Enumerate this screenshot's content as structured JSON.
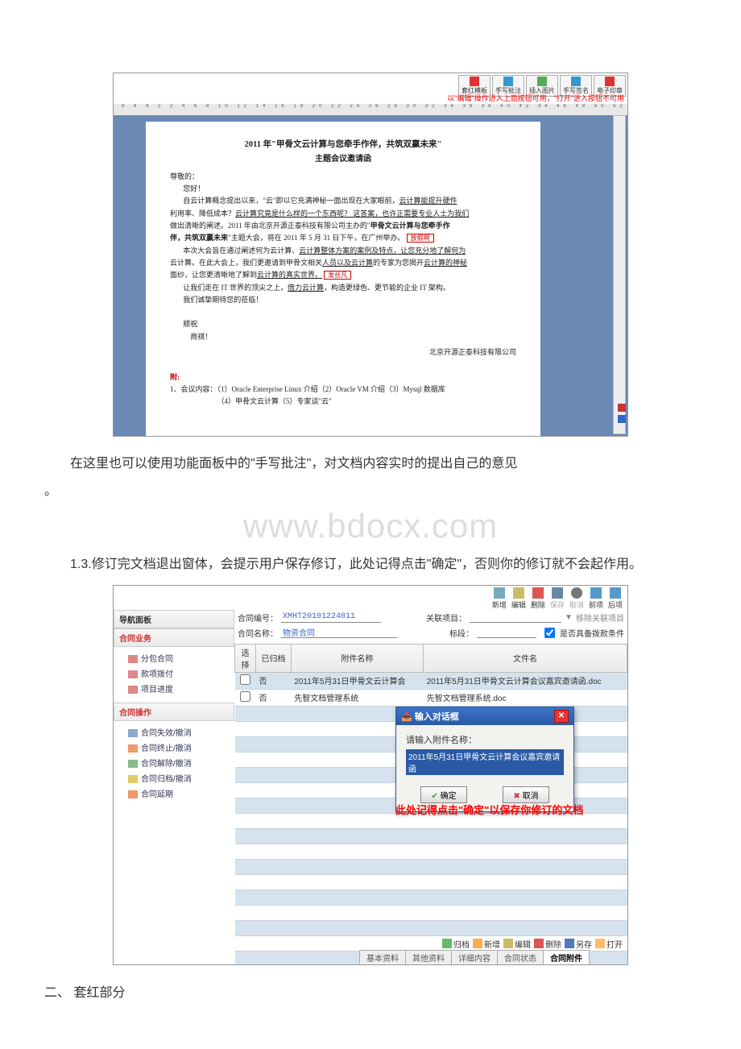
{
  "shot1": {
    "toolbar": [
      "套红模板",
      "手写批注",
      "插入图片",
      "手写签名",
      "电子印章"
    ],
    "redhint": "以\"编辑\"操作进入上面按钮可用，\"打开\"进入按钮不可用",
    "ruler": "8 6 4 2 2 4 6 8 10 12 14 16 18 20 22 24 26 28 30 32 34 36 38 40 42 44 46 48 50 52",
    "doc": {
      "title": "2011 年\"甲骨文云计算与您牵手作伴，共筑双赢未来\"",
      "sub": "主题会议邀请函",
      "p_open": "尊敬的：",
      "p_hello": "您好！",
      "p1a": "自云计算概念提出以来，\"云\"即以它充满神秘一面出现在大家眼前，",
      "p1b": "云计算能提升硬件",
      "p2a": "利用率、降低成本？",
      "p2b": "云计算究竟是什么样的一个东西呢？ 这答案，也许正需要专业人士为我们",
      "p3a": "做出清晰的阐述。2011 年由北京开源正泰科技有限公司主办的\"",
      "p3b": "甲骨文云计算与您牵手作",
      "p4a": "伴，共筑双赢未来",
      "p4b": "\"主题大会，将在 2011 年 5 月 31 日下午，在广州举办。",
      "redbox1": "放假啊",
      "p5a": "本次大会旨在通过阐述何为云计算、",
      "p5b": "云计算整体方案的案例及特点，让您充分地了解何为",
      "p6a": "云计算。在此大会上，我们更邀请到甲骨文相关",
      "p6b": "人员以及云计算",
      "p6c": "的专家为您揭开",
      "p6d": "云计算的神秘",
      "p7a": "面纱，让您更清晰地了解到",
      "p7b": "云计算的真实世界。",
      "redbox2": "发丝凡",
      "p8a": "让我们走在 IT 世界的顶尖之上，",
      "p8b": "借力云计算",
      "p8c": "，构造更绿色、更节能的企业 IT 架构。",
      "p9": "我们诚挚期待您的莅临！",
      "p10": "顺祝",
      "p11": "商祺！",
      "sig": "北京开源正泰科技有限公司",
      "att": "附:",
      "attline": "1、会议内容：（1）Oracle Enterprise Linux 介绍（2）Oracle VM 介绍（3）Mysql 数据库",
      "attline2": "（4）甲骨文云计算（5）专家谈\"云\""
    }
  },
  "midtext1": "在这里也可以使用功能面板中的\"手写批注\"，对文档内容实时的提出自己的意见",
  "midtext1b": "。",
  "watermark": "www.bdocx.com",
  "midtext2": "1.3.修订完文档退出窗体，会提示用户保存修订，此处记得点击\"确定\"，否则你的修订就不会起作用。",
  "shot2": {
    "topActions": {
      "new": "新增",
      "edit": "编辑",
      "del": "删除",
      "save": "保存",
      "cancel": "取消",
      "prev": "前项",
      "next": "后项"
    },
    "left": {
      "nav": "导航面板",
      "biz": "合同业务",
      "bizItems": [
        "分包合同",
        "款项拨付",
        "项目进度"
      ],
      "ops": "合同操作",
      "opsItems": [
        "合同失效/撤消",
        "合同终止/撤消",
        "合同解除/撤消",
        "合同归档/撤消",
        "合同延期"
      ]
    },
    "form": {
      "l_no": "合同编号：",
      "no": "XMHT20101224011",
      "l_rel": "关联项目：",
      "relremove": "移除关联项目",
      "l_name": "合同名称：",
      "name": "物资合同",
      "l_stage": "标段：",
      "chk": "是否具备拨款条件"
    },
    "table": {
      "h_sel": "选择",
      "h_arch": "已归档",
      "h_attname": "附件名称",
      "h_filename": "文件名",
      "rows": [
        {
          "arch": "否",
          "att": "2011年5月31日甲骨文云计算会",
          "file": "2011年5月31日甲骨文云计算会议嘉宾邀请函.doc"
        },
        {
          "arch": "否",
          "att": "先智文档管理系统",
          "file": "先智文档管理系统.doc"
        }
      ]
    },
    "dlg": {
      "title": "输入对话框",
      "prompt": "请输入附件名称：",
      "val": "2011年5月31日甲骨文云计算会议嘉宾邀请函",
      "ok": "确定",
      "cancel": "取消"
    },
    "redanno": "此处记得点击\"确定\"以保存你修订的文档",
    "bottom": {
      "arch": "归档",
      "add": "新增",
      "edit": "编辑",
      "del": "删除",
      "save": "另存",
      "open": "打开"
    },
    "tabs": [
      "基本资料",
      "其他资料",
      "详细内容",
      "合同状态",
      "合同附件"
    ]
  },
  "sectionHead": "二、 套红部分"
}
